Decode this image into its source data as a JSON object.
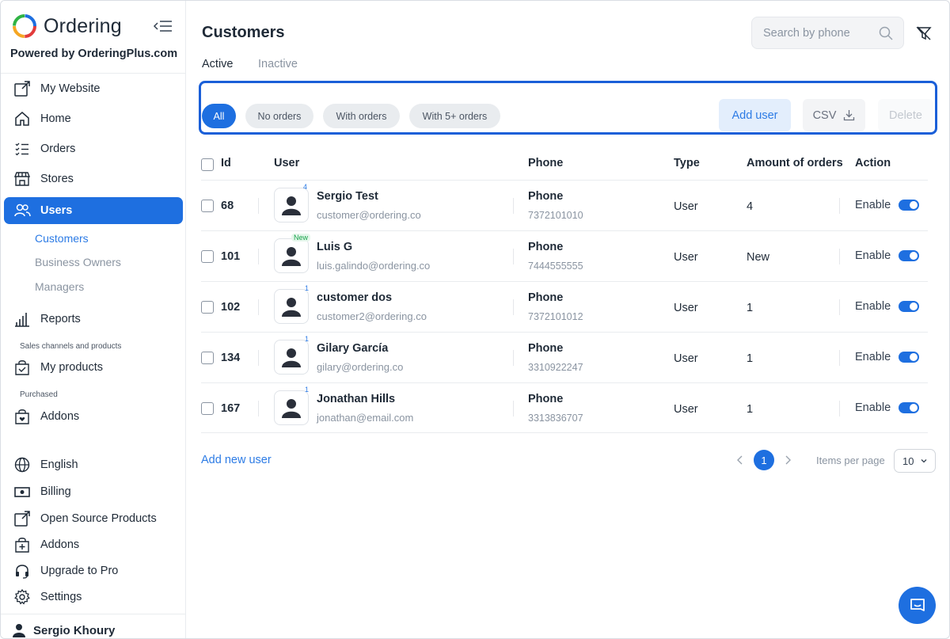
{
  "brand": {
    "name": "Ordering",
    "powered_by": "Powered by OrderingPlus.com"
  },
  "sidebar": {
    "items": [
      {
        "label": "My Website"
      },
      {
        "label": "Home"
      },
      {
        "label": "Orders"
      },
      {
        "label": "Stores"
      },
      {
        "label": "Users"
      }
    ],
    "users_sub": [
      "Customers",
      "Business Owners",
      "Managers"
    ],
    "reports": "Reports",
    "caption_sales": "Sales channels and products",
    "my_products": "My products",
    "caption_purchased": "Purchased",
    "addons_purchased": "Addons",
    "bottom": [
      "English",
      "Billing",
      "Open Source Products",
      "Addons",
      "Upgrade to Pro",
      "Settings"
    ],
    "user_name": "Sergio Khoury"
  },
  "header": {
    "title": "Customers",
    "search_placeholder": "Search by phone"
  },
  "tabs": [
    "Active",
    "Inactive"
  ],
  "filters": [
    "All",
    "No orders",
    "With orders",
    "With 5+ orders"
  ],
  "actions": {
    "add_user": "Add user",
    "csv": "CSV",
    "delete": "Delete"
  },
  "table": {
    "headers": {
      "id": "Id",
      "user": "User",
      "phone": "Phone",
      "type": "Type",
      "orders": "Amount of orders",
      "action": "Action"
    },
    "rows": [
      {
        "id": "68",
        "badge": "4",
        "name": "Sergio Test",
        "email": "customer@ordering.co",
        "phone_label": "Phone",
        "phone": "7372101010",
        "type": "User",
        "orders": "4",
        "action": "Enable"
      },
      {
        "id": "101",
        "badge": "New",
        "name": "Luis G",
        "email": "luis.galindo@ordering.co",
        "phone_label": "Phone",
        "phone": "7444555555",
        "type": "User",
        "orders": "New",
        "action": "Enable"
      },
      {
        "id": "102",
        "badge": "1",
        "name": "customer dos",
        "email": "customer2@ordering.co",
        "phone_label": "Phone",
        "phone": "7372101012",
        "type": "User",
        "orders": "1",
        "action": "Enable"
      },
      {
        "id": "134",
        "badge": "1",
        "name": "Gilary García",
        "email": "gilary@ordering.co",
        "phone_label": "Phone",
        "phone": "3310922247",
        "type": "User",
        "orders": "1",
        "action": "Enable"
      },
      {
        "id": "167",
        "badge": "1",
        "name": "Jonathan Hills",
        "email": "jonathan@email.com",
        "phone_label": "Phone",
        "phone": "3313836707",
        "type": "User",
        "orders": "1",
        "action": "Enable"
      }
    ]
  },
  "footer": {
    "add_new": "Add new user",
    "current_page": "1",
    "items_per_page_label": "Items per page",
    "items_per_page": "10"
  },
  "colors": {
    "primary": "#1e6fe0",
    "highlight_border": "#1a5fd8"
  }
}
